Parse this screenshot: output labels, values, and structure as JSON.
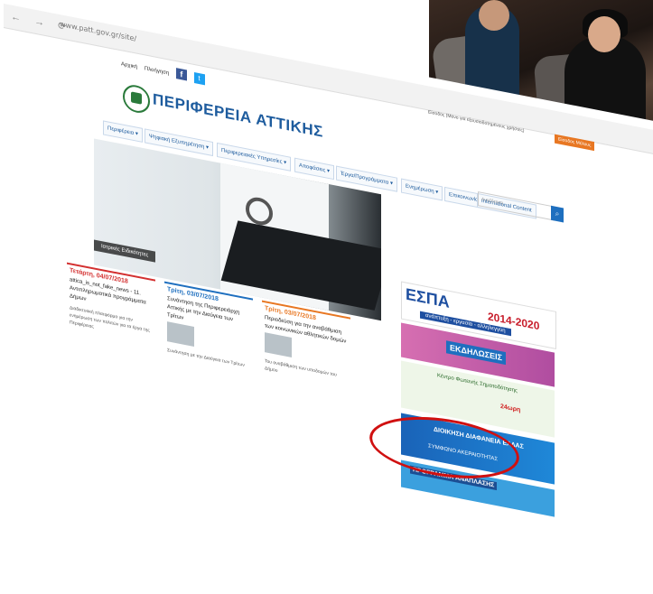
{
  "browser": {
    "url": "www.patt.gov.gr/site/"
  },
  "topbar": {
    "home": "Αρχική",
    "print": "Πλοήγηση",
    "facebook": "f",
    "twitter": "t"
  },
  "site": {
    "title": "ΠΕΡΙΦΕΡΕΙΑ ΑΤΤΙΚΗΣ"
  },
  "user": {
    "link": "Είσοδος (Μόνο για εξουσιοδοτημένους χρήστες)",
    "button": "Είσοδος Μέλους"
  },
  "menu": [
    "Περιφέρεια ▾",
    "Ψηφιακή Εξυπηρέτηση ▾",
    "Περιφερειακές Υπηρεσίες ▾",
    "Αποφάσεις ▾",
    "Έργα/Προγράμματα ▾",
    "Ενημέρωση ▾",
    "Επικοινωνία",
    "International Content"
  ],
  "search": {
    "placeholder": "Αναζήτηση",
    "icon": "search-icon"
  },
  "hero": {
    "label": "Ιατρικές Ειδικότητες"
  },
  "banners": {
    "espa_title": "ΕΣΠΑ",
    "espa_years": "2014-2020",
    "espa_slogan": "ανάπτυξη - εργασία - αλληλεγγύη",
    "ekdiloseis": "ΕΚΔΗΛΩΣΕΙΣ",
    "kentro": "Κέντρο Φωτεινής Σηματοδότησης",
    "kentro_hours": "24ωρη",
    "diafaneia": "ΔΙΟΙΚΗΣΗ ΔΙΑΦΑΝΕΙΑ ΕΛΛΑΣ",
    "symfono": "ΣΥΜΦΩΝΟ ΑΚΕΡΑΙΟΤΗΤΑΣ",
    "programma": "ΠΡΟΓΡΑΜΜΑ ΑΝΑΠΛΑΣΗΣ"
  },
  "news": [
    {
      "date": "Τετάρτη, 04/07/2018",
      "title": "attica_is_not_fake_news - 11. Αντιπληρωματικά προγράμματα Δήμων",
      "text": "Διαδικτυακή πλατφόρμα για την ενημέρωση των πολιτών για τα έργα της Περιφέρειας"
    },
    {
      "date": "Τρίτη, 03/07/2018",
      "title": "Συνάντηση της Περιφερειάρχη Αττικής με την Διαύγεια των Τρίτων",
      "text": "Συνάντηση με την Διαύγεια των Τρίτων"
    },
    {
      "date": "Τρίτη, 03/07/2018",
      "title": "Περιοδεύση για την αναβάθμιση των κοινωνικών αθλητικών δομών",
      "text": "Του αναβάθμιση των υποδομών του Δήμου"
    }
  ],
  "colors": {
    "brand": "#1e5c9e",
    "accent": "#e87722",
    "highlight": "#d01010"
  }
}
